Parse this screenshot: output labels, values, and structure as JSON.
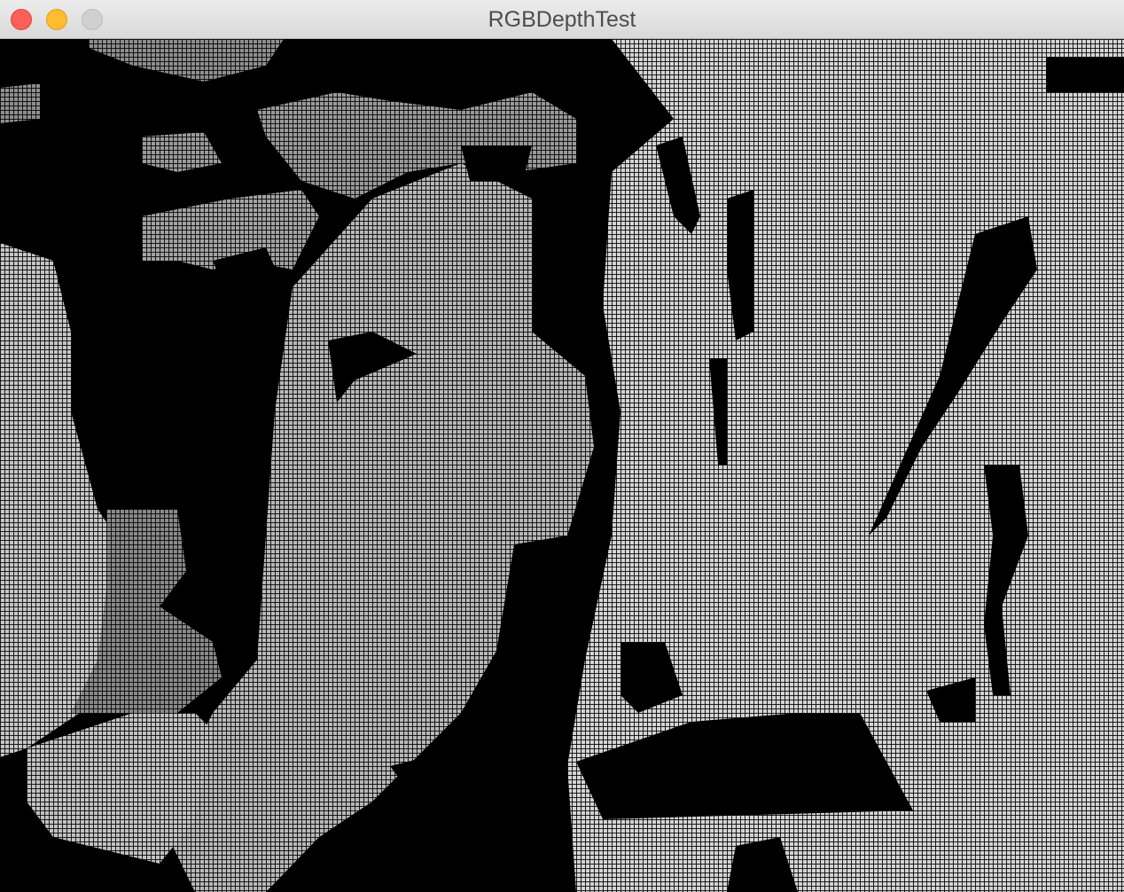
{
  "window": {
    "title": "RGBDepthTest",
    "controls": {
      "close_color": "#fe5f57",
      "minimize_color": "#febc2e",
      "zoom_color": "#d0d0d0"
    }
  },
  "depth_view": {
    "background": "#000000",
    "palette": {
      "far": "#000000",
      "mid_dark": "#7a7a7a",
      "mid": "#9c9c9c",
      "near": "#bdbdbd",
      "nearest": "#d4d4d4"
    }
  }
}
